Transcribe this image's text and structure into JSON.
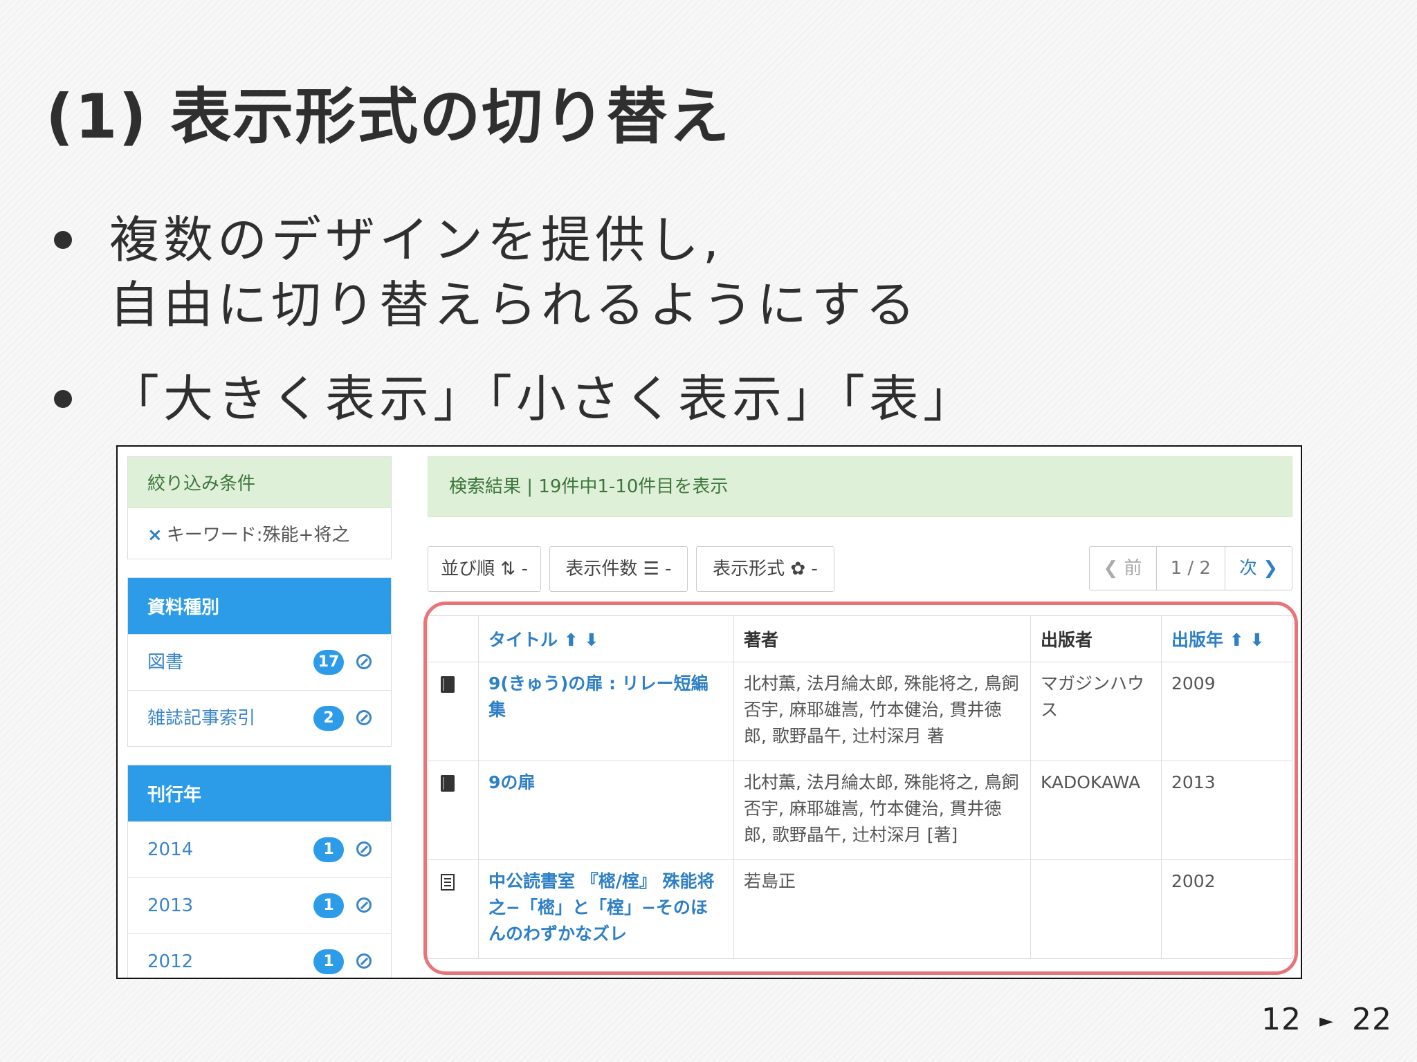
{
  "slide": {
    "title": "(1) 表示形式の切り替え",
    "bullets": [
      {
        "line1": "複数のデザインを提供し,",
        "line2": "自由に切り替えられるようにする"
      },
      {
        "line1": "「大きく表示」「小さく表示」「表」"
      }
    ],
    "page_current": "12",
    "page_arrow": "►",
    "page_total": "22"
  },
  "screenshot": {
    "filter": {
      "header": "絞り込み条件",
      "keyword": "キーワード:殊能+将之",
      "keyword_icon": "×"
    },
    "facets": [
      {
        "header": "資料種別",
        "items": [
          {
            "label": "図書",
            "count": "17"
          },
          {
            "label": "雑誌記事索引",
            "count": "2"
          }
        ]
      },
      {
        "header": "刊行年",
        "items": [
          {
            "label": "2014",
            "count": "1"
          },
          {
            "label": "2013",
            "count": "1"
          },
          {
            "label": "2012",
            "count": "1"
          }
        ]
      }
    ],
    "result_summary": "検索結果 | 19件中1-10件目を表示",
    "toolbar": {
      "sort": "並び順 ⇅ -",
      "count": "表示件数 ☰ -",
      "format": "表示形式 ✿ -"
    },
    "pager": {
      "prev": "❮ 前",
      "page": "1 / 2",
      "next": "次 ❯"
    },
    "table": {
      "headers": {
        "title": "タイトル ⬆ ⬇",
        "author": "著者",
        "publisher": "出版者",
        "year": "出版年 ⬆ ⬇"
      },
      "rows": [
        {
          "icon": "book-icon",
          "title": "9(きゅう)の扉 : リレー短編集",
          "author": "北村薫, 法月綸太郎, 殊能将之, 鳥飼否宇, 麻耶雄嵩, 竹本健治, 貫井徳郎, 歌野晶午, 辻村深月 著",
          "publisher": "マガジンハウス",
          "year": "2009"
        },
        {
          "icon": "book-icon",
          "title": "9の扉",
          "author": "北村薫, 法月綸太郎, 殊能将之, 鳥飼否宇, 麻耶雄嵩, 竹本健治, 貫井徳郎, 歌野晶午, 辻村深月 [著]",
          "publisher": "KADOKAWA",
          "year": "2013"
        },
        {
          "icon": "article-icon",
          "title": "中公読書室 『樒/榁』 殊能将之−「樒」と「榁」−そのほんのわずかなズレ",
          "author": "若島正",
          "publisher": "",
          "year": "2002"
        }
      ]
    }
  },
  "colors": {
    "accent": "#2d9ce8",
    "link": "#2d7fc6",
    "success_bg": "#dff0d8",
    "highlight": "#e8747a"
  }
}
